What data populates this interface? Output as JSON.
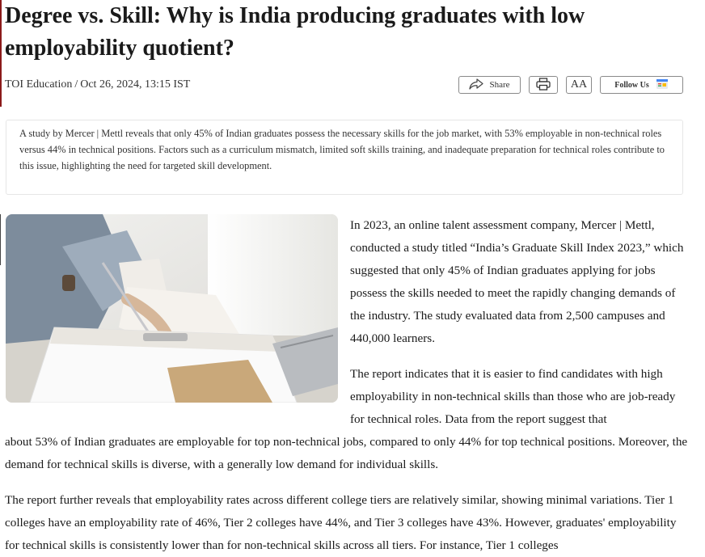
{
  "article": {
    "title": "Degree vs. Skill: Why is India producing graduates with low employability quotient?",
    "author": "TOI Education",
    "byline_separator": "/",
    "date": "Oct 26, 2024, 13:15 IST"
  },
  "toolbar": {
    "share_label": "Share",
    "print_icon": "printer-icon",
    "font_size_label": "AA",
    "follow_label": "Follow Us",
    "follow_icon": "google-news-icon",
    "share_icon": "share-arrow-icon"
  },
  "summary": {
    "text": "A study by Mercer | Mettl reveals that only 45% of Indian graduates possess the necessary skills for the job market, with 53% employable in non-technical roles versus 44% in technical positions. Factors such as a curriculum mismatch, limited soft skills training, and inadequate preparation for technical roles contribute to this issue, highlighting the need for targeted skill development."
  },
  "body": {
    "p1": "In 2023, an online talent assessment company, Mercer | Mettl, conducted a study titled “India’s Graduate Skill Index 2023,” which suggested that only 45% of Indian graduates applying for jobs possess the skills needed to meet the rapidly changing demands of the industry. The study evaluated data from 2,500 campuses and 440,000 learners.",
    "p2a": "The report indicates that it is easier to find candidates with high employability in non-technical skills than those who are job-ready for technical roles. Data from the report suggest that",
    "p2b": "about 53% of Indian graduates are employable for top non-technical jobs, compared to only 44% for top technical positions. Moreover, the demand for technical skills is diverse, with a generally low demand for individual skills.",
    "p3": "The report further reveals that employability rates across different college tiers are relatively similar, showing minimal variations. Tier 1 colleges have an employability rate of 46%, Tier 2 colleges have 44%, and Tier 3 colleges have 43%. However, graduates' employability for technical skills is consistently lower than for non-technical skills across all tiers. For instance, Tier 1 colleges"
  },
  "colors": {
    "accent_rule": "#8b1a1a",
    "text": "#1a1a1a",
    "border": "#e6e6e6"
  }
}
